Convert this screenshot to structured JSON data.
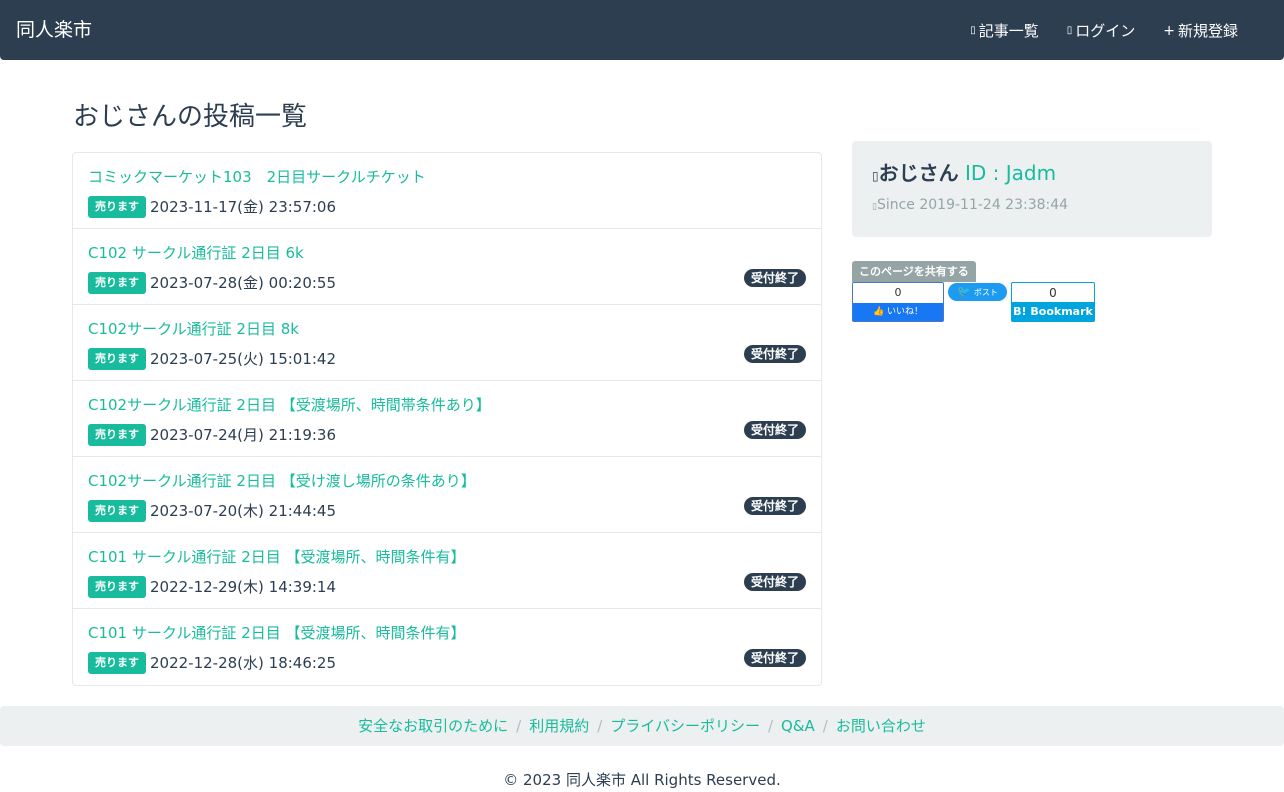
{
  "navbar": {
    "brand": "同人楽市",
    "links": [
      {
        "icon": "list-icon",
        "label": "記事一覧"
      },
      {
        "icon": "login-icon",
        "label": "ログイン"
      },
      {
        "icon": "plus-icon",
        "label": "新規登録"
      }
    ]
  },
  "page": {
    "title": "おじさんの投稿一覧"
  },
  "posts": [
    {
      "title": "コミックマーケット103　2日目サークルチケット",
      "type": "売ります",
      "date": "2023-11-17(金) 23:57:06",
      "status": ""
    },
    {
      "title": "C102 サークル通行証 2日目 6k",
      "type": "売ります",
      "date": "2023-07-28(金) 00:20:55",
      "status": "受付終了"
    },
    {
      "title": "C102サークル通行証 2日目 8k",
      "type": "売ります",
      "date": "2023-07-25(火) 15:01:42",
      "status": "受付終了"
    },
    {
      "title": "C102サークル通行証 2日目 【受渡場所、時間帯条件あり】",
      "type": "売ります",
      "date": "2023-07-24(月) 21:19:36",
      "status": "受付終了"
    },
    {
      "title": "C102サークル通行証 2日目 【受け渡し場所の条件あり】",
      "type": "売ります",
      "date": "2023-07-20(木) 21:44:45",
      "status": "受付終了"
    },
    {
      "title": "C101 サークル通行証 2日目 【受渡場所、時間条件有】",
      "type": "売ります",
      "date": "2022-12-29(木) 14:39:14",
      "status": "受付終了"
    },
    {
      "title": "C101 サークル通行証 2日目 【受渡場所、時間条件有】",
      "type": "売ります",
      "date": "2022-12-28(水) 18:46:25",
      "status": "受付終了"
    }
  ],
  "profile": {
    "name": "おじさん",
    "id_label": " ID : Jadm",
    "since": "Since 2019-11-24 23:38:44"
  },
  "share": {
    "label": "このページを共有する",
    "facebook_count": "0",
    "facebook_like": "いいね！",
    "twitter_label": "ポスト",
    "hatena_count": "0",
    "hatena_label": "B! Bookmark"
  },
  "footer": {
    "links": [
      "安全なお取引のために",
      "利用規約",
      "プライバシーポリシー",
      "Q&A",
      "お問い合わせ"
    ],
    "copyright": "© 2023 同人楽市 All Rights Reserved."
  },
  "colors": {
    "navbar_bg": "#2c3e50",
    "accent": "#18bc9c",
    "sell_badge": "#18bc9c",
    "closed_badge": "#2c3e50",
    "card_bg": "#ecf0f1",
    "muted": "#95a5a6"
  }
}
